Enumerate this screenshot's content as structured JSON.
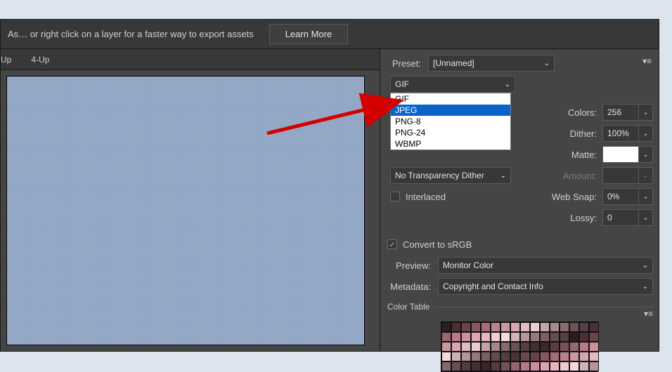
{
  "hint": {
    "text": "As…  or right click on a layer for a faster way to export assets",
    "learn_more": "Learn More"
  },
  "tabs": {
    "up": "Up",
    "fourup": "4-Up"
  },
  "preset": {
    "label": "Preset:",
    "value": "[Unnamed]"
  },
  "format": {
    "value": "GIF",
    "options": {
      "gif": "GIF",
      "jpeg": "JPEG",
      "png8": "PNG-8",
      "png24": "PNG-24",
      "wbmp": "WBMP"
    }
  },
  "right": {
    "colors_label": "Colors:",
    "colors_value": "256",
    "dither_label": "Dither:",
    "dither_value": "100%",
    "matte_label": "Matte:",
    "amount_label": "Amount:",
    "amount_value": "",
    "websnap_label": "Web Snap:",
    "websnap_value": "0%",
    "lossy_label": "Lossy:",
    "lossy_value": "0"
  },
  "left": {
    "transparency_dither": "No Transparency Dither",
    "interlaced_label": "Interlaced"
  },
  "srgb": {
    "label": "Convert to sRGB"
  },
  "preview": {
    "label": "Preview:",
    "value": "Monitor Color"
  },
  "metadata": {
    "label": "Metadata:",
    "value": "Copyright and Contact Info"
  },
  "color_table": {
    "legend": "Color Table"
  }
}
